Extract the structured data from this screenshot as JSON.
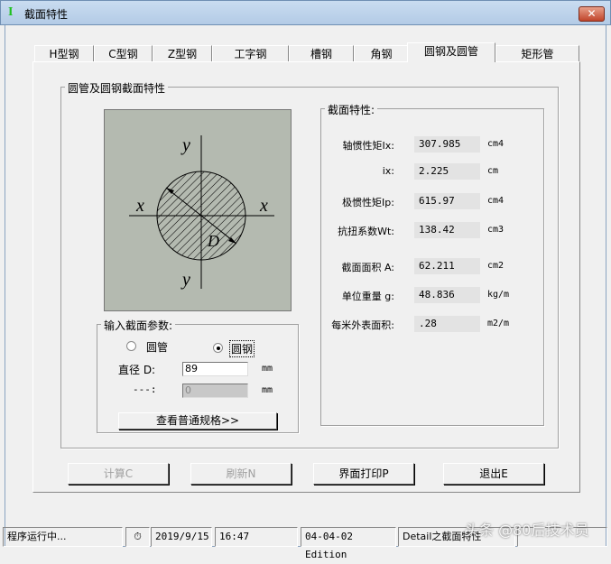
{
  "window": {
    "title": "截面特性",
    "app_icon": "I-beam-icon",
    "close": "✕"
  },
  "tabs": [
    {
      "label": "H型钢"
    },
    {
      "label": "C型钢"
    },
    {
      "label": "Z型钢"
    },
    {
      "label": "工字钢"
    },
    {
      "label": "槽钢"
    },
    {
      "label": "角钢"
    },
    {
      "label": "圆钢及圆管",
      "selected": true
    },
    {
      "label": "矩形管"
    }
  ],
  "main_group": {
    "title": "圆管及圆钢截面特性"
  },
  "figure": {
    "y_label": "y",
    "x_label": "x",
    "d_label": "D"
  },
  "properties": {
    "title": "截面特性:",
    "rows": [
      {
        "label": "轴惯性矩Ix:",
        "value": "307.985",
        "unit": "cm4"
      },
      {
        "label": "ix:",
        "value": "2.225",
        "unit": "cm"
      },
      {
        "label": "极惯性矩Ip:",
        "value": "615.97",
        "unit": "cm4"
      },
      {
        "label": "抗扭系数Wt:",
        "value": "138.42",
        "unit": "cm3"
      },
      {
        "label": "截面面积 A:",
        "value": "62.211",
        "unit": "cm2"
      },
      {
        "label": "单位重量 g:",
        "value": "48.836",
        "unit": "kg/m"
      },
      {
        "label": "每米外表面积:",
        "value": ".28",
        "unit": "m2/m"
      }
    ]
  },
  "input": {
    "title": "输入截面参数:",
    "radio_tube": "圆管",
    "radio_bar": "圆钢",
    "selected": "圆钢",
    "diameter_label": "直径 D:",
    "diameter_value": "89",
    "diameter_unit": "mm",
    "thickness_label": "---:",
    "thickness_value": "0",
    "thickness_unit": "mm",
    "spec_button": "查看普通规格>>"
  },
  "buttons": {
    "calc": "计算C",
    "refresh": "刷新N",
    "print": "界面打印P",
    "exit": "退出E"
  },
  "status": {
    "state": "程序运行中...",
    "date": "2019/9/15",
    "time": "16:47",
    "edition": "04-04-02 Edition",
    "module": "Detail之截面特性",
    "watermark": "头条 @80后技术员"
  }
}
